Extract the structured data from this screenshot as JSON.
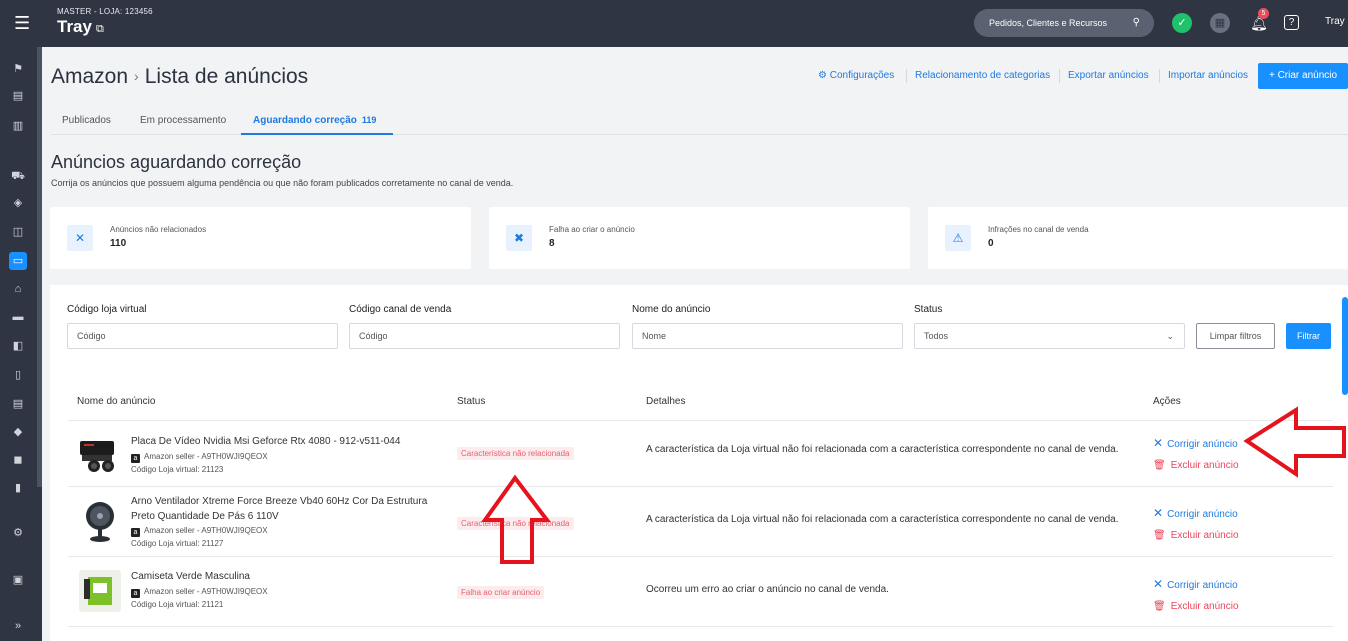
{
  "topbar": {
    "store_line": "MASTER - LOJA: 123456",
    "store_name": "Tray",
    "search_label": "Pedidos, Clientes e Recursos",
    "notif_count": "5",
    "user": "Tray"
  },
  "page": {
    "breadcrumb_root": "Amazon",
    "breadcrumb_sep": "›",
    "breadcrumb_current": "Lista de anúncios",
    "actions": {
      "config": "Configurações",
      "categories": "Relacionamento de categorias",
      "export": "Exportar anúncios",
      "import": "Importar anúncios",
      "create": "+ Criar anúncio"
    },
    "tabs": [
      {
        "label": "Publicados"
      },
      {
        "label": "Em processamento"
      },
      {
        "label": "Aguardando correção",
        "count": "119"
      }
    ],
    "section_title": "Anúncios aguardando correção",
    "section_subtitle": "Corrija os anúncios que possuem alguma pendência ou que não foram publicados corretamente no canal de venda."
  },
  "cards": [
    {
      "label": "Anúncios não relacionados",
      "value": "110",
      "icon": "close-icon",
      "glyph": "✕"
    },
    {
      "label": "Falha ao criar o anúncio",
      "value": "8",
      "icon": "tools-icon",
      "glyph": "✖"
    },
    {
      "label": "Infrações no canal de venda",
      "value": "0",
      "icon": "warning-icon",
      "glyph": "⚠"
    }
  ],
  "filters": {
    "code_label": "Código loja virtual",
    "code_placeholder": "Código",
    "channel_label": "Código canal de venda",
    "channel_placeholder": "Código",
    "name_label": "Nome do anúncio",
    "name_placeholder": "Nome",
    "status_label": "Status",
    "status_value": "Todos",
    "clear": "Limpar filtros",
    "submit": "Filtrar"
  },
  "table": {
    "headers": [
      "Nome do anúncio",
      "Status",
      "Detalhes",
      "Ações"
    ],
    "fix_label": "Corrigir anúncio",
    "delete_label": "Excluir anúncio",
    "rows": [
      {
        "name": "Placa De Vídeo Nvidia Msi Geforce Rtx 4080 - 912-v511-044",
        "seller": "Amazon seller - A9TH0WJI9QEOX",
        "code": "Código Loja virtual: 21123",
        "status": "Característica não relacionada",
        "details": "A característica da Loja virtual não foi relacionada com a característica correspondente no canal de venda."
      },
      {
        "name": "Arno Ventilador Xtreme Force Breeze Vb40 60Hz Cor Da Estrutura Preto Quantidade De Pás 6 110V",
        "seller": "Amazon seller - A9TH0WJI9QEOX",
        "code": "Código Loja virtual: 21127",
        "status": "Característica não relacionada",
        "details": "A característica da Loja virtual não foi relacionada com a característica correspondente no canal de venda."
      },
      {
        "name": "Camiseta Verde Masculina",
        "seller": "Amazon seller - A9TH0WJI9QEOX",
        "code": "Código Loja virtual: 21121",
        "status": "Falha ao criar anúncio",
        "details": "Ocorreu um erro ao criar o anúncio no canal de venda."
      }
    ]
  },
  "colors": {
    "accent": "#1890ff",
    "topbar": "#2f3542",
    "danger": "#e8475a",
    "annotation": "#e5141c"
  }
}
